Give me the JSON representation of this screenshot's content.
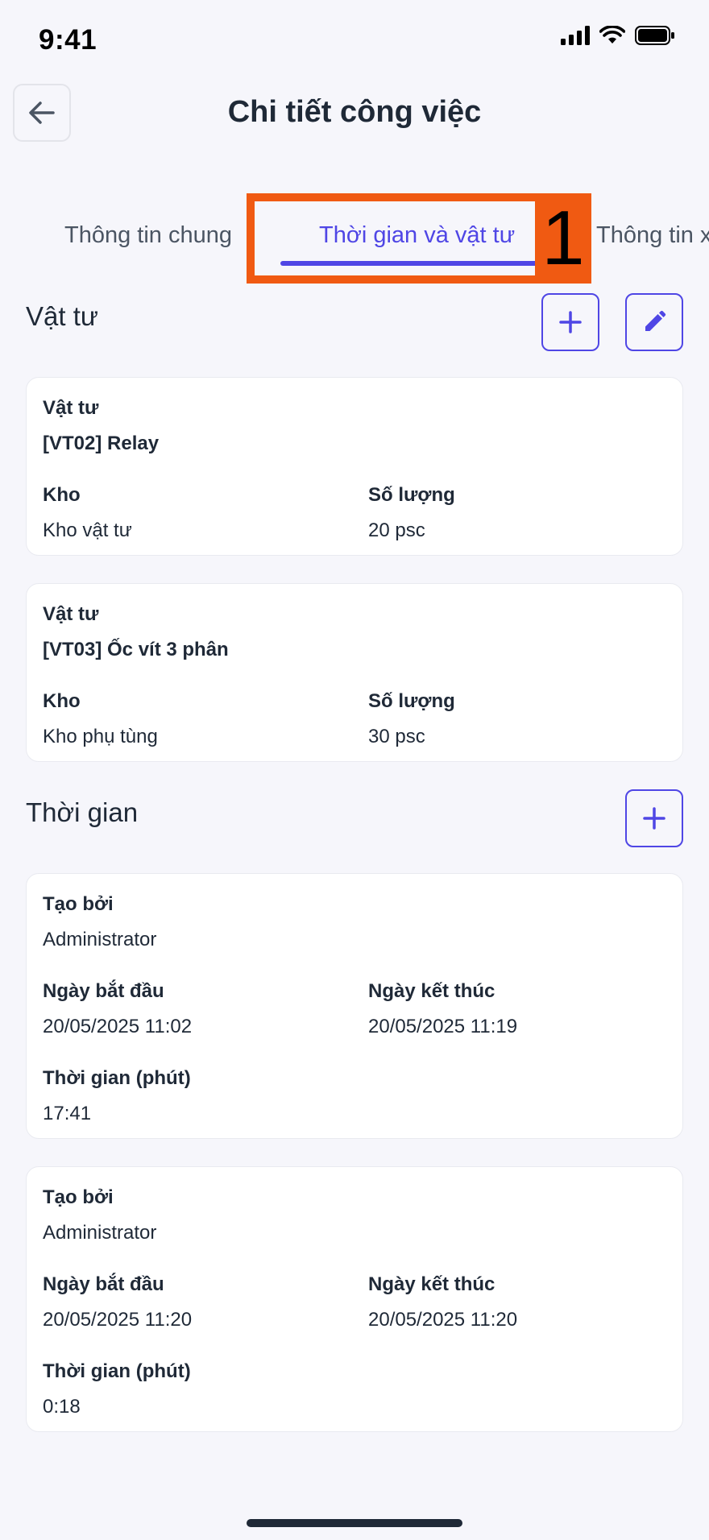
{
  "status": {
    "time": "9:41"
  },
  "header": {
    "title": "Chi tiết công việc"
  },
  "tabs": [
    {
      "label": "Thông tin chung"
    },
    {
      "label": "Thời gian và vật tư"
    },
    {
      "label": "Thông tin x"
    }
  ],
  "annotation": {
    "number": "1"
  },
  "materials": {
    "title": "Vật tư",
    "items": [
      {
        "material_label": "Vật tư",
        "material": "[VT02] Relay",
        "warehouse_label": "Kho",
        "warehouse": "Kho vật tư",
        "qty_label": "Số lượng",
        "qty": "20 psc"
      },
      {
        "material_label": "Vật tư",
        "material": "[VT03] Ốc vít 3 phân",
        "warehouse_label": "Kho",
        "warehouse": "Kho phụ tùng",
        "qty_label": "Số lượng",
        "qty": "30 psc"
      }
    ]
  },
  "time": {
    "title": "Thời gian",
    "entries": [
      {
        "creator_label": "Tạo bởi",
        "creator": "Administrator",
        "start_label": "Ngày bắt đầu",
        "start": "20/05/2025 11:02",
        "end_label": "Ngày kết thúc",
        "end": "20/05/2025 11:19",
        "duration_label": "Thời gian (phút)",
        "duration": "17:41"
      },
      {
        "creator_label": "Tạo bởi",
        "creator": "Administrator",
        "start_label": "Ngày bắt đầu",
        "start": "20/05/2025 11:20",
        "end_label": "Ngày kết thúc",
        "end": "20/05/2025 11:20",
        "duration_label": "Thời gian (phút)",
        "duration": "0:18"
      }
    ]
  },
  "colors": {
    "accent": "#4f46e5",
    "annotation": "#f05a12",
    "background": "#f6f6fb"
  },
  "icons": {
    "back": "arrow-left-icon",
    "add": "plus-icon",
    "edit": "pencil-icon"
  }
}
